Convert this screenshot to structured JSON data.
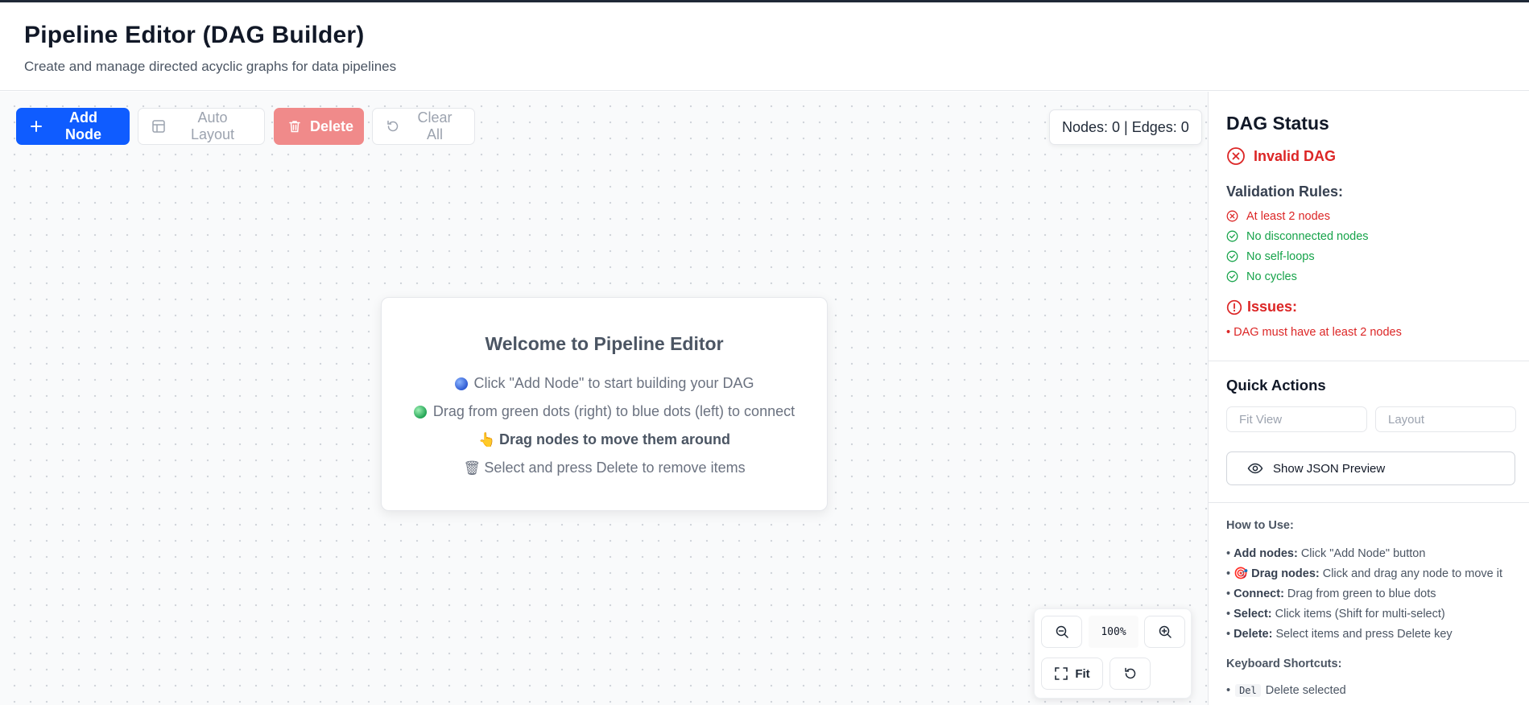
{
  "header": {
    "title": "Pipeline Editor (DAG Builder)",
    "subtitle": "Create and manage directed acyclic graphs for data pipelines"
  },
  "toolbar": {
    "add_node": "Add Node",
    "auto_layout": "Auto Layout",
    "delete": "Delete",
    "clear_all": "Clear All"
  },
  "counter": "Nodes: 0 | Edges: 0",
  "welcome": {
    "title": "Welcome to Pipeline Editor",
    "lines": [
      "Click \"Add Node\" to start building your DAG",
      "Drag from green dots (right) to blue dots (left) to connect",
      "Drag nodes to move them around",
      "Select and press Delete to remove items"
    ],
    "icons": [
      "👆",
      "🗑"
    ]
  },
  "zoom": {
    "level": "100%",
    "fit_label": "Fit"
  },
  "sidebar": {
    "status_title": "DAG Status",
    "status": "Invalid DAG",
    "rules_title": "Validation Rules:",
    "rules": [
      {
        "label": "At least 2 nodes",
        "ok": false
      },
      {
        "label": "No disconnected nodes",
        "ok": true
      },
      {
        "label": "No self-loops",
        "ok": true
      },
      {
        "label": "No cycles",
        "ok": true
      }
    ],
    "issues_title": "Issues:",
    "issues": [
      "DAG must have at least 2 nodes"
    ],
    "quick_actions_title": "Quick Actions",
    "fit_view": "Fit View",
    "layout": "Layout",
    "json_preview": "Show JSON Preview",
    "howto_title": "How to Use:",
    "howto": [
      {
        "term": "Add nodes:",
        "text": "Click \"Add Node\" button"
      },
      {
        "term": "Drag nodes:",
        "text": "Click and drag any node to move it",
        "icon": "🎯"
      },
      {
        "term": "Connect:",
        "text": "Drag from green to blue dots"
      },
      {
        "term": "Select:",
        "text": "Click items (Shift for multi-select)"
      },
      {
        "term": "Delete:",
        "text": "Select items and press Delete key"
      }
    ],
    "shortcuts_title": "Keyboard Shortcuts:",
    "shortcuts": [
      {
        "key": "Del",
        "text": "Delete selected"
      }
    ]
  },
  "colors": {
    "primary": "#0f5cff",
    "danger": "#dc2626",
    "danger_light": "#f08a8a",
    "success": "#16a34a"
  }
}
